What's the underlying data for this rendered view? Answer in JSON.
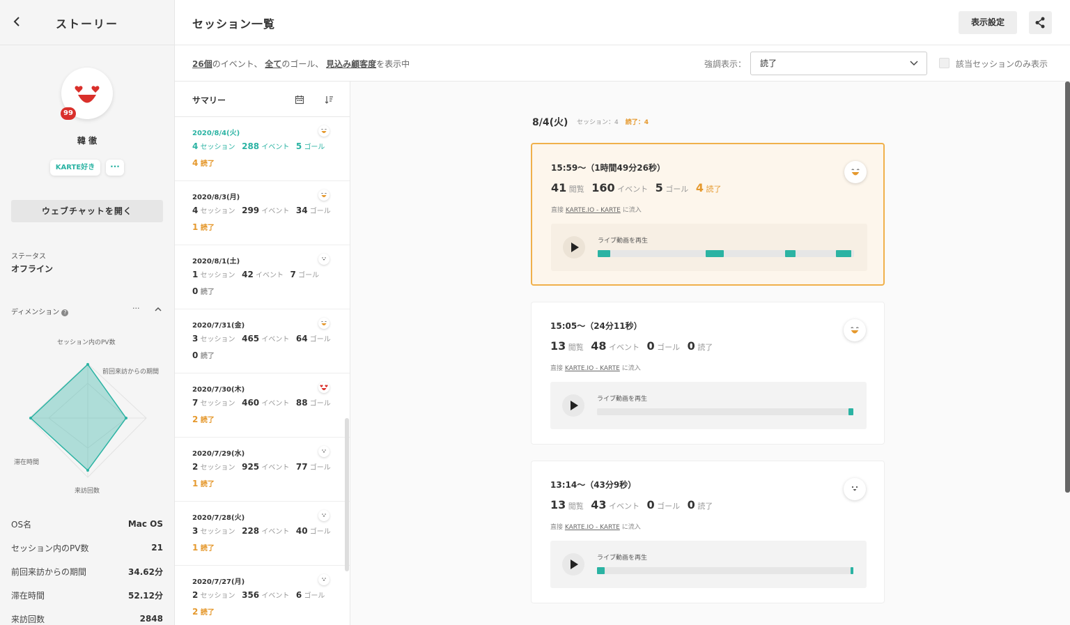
{
  "profile": {
    "title": "ストーリー",
    "badge": "99",
    "name": "韓 徹",
    "tag": "KARTE好き",
    "more": "···",
    "webchat_button": "ウェブチャットを開く",
    "status_label": "ステータス",
    "status_value": "オフライン",
    "dimension_title": "ディメンション",
    "dimension_help": "?",
    "dimension_more": "···",
    "radar_labels": {
      "top": "セッション内のPV数",
      "right": "前回来訪からの期間",
      "left": "滞在時間",
      "bottom": "来訪回数"
    },
    "stats": [
      {
        "label": "OS名",
        "value": "Mac OS"
      },
      {
        "label": "セッション内のPV数",
        "value": "21"
      },
      {
        "label": "前回来訪からの期間",
        "value": "34.62分"
      },
      {
        "label": "滞在時間",
        "value": "52.12分"
      },
      {
        "label": "来訪回数",
        "value": "2848"
      }
    ]
  },
  "header": {
    "title": "セッション一覧",
    "display_settings": "表示設定"
  },
  "filter": {
    "events_count": "26個",
    "events_text": "のイベント、",
    "goals_link": "全て",
    "goals_text": "のゴール、",
    "segment_link": "見込み顧客度",
    "segment_text": "を表示中",
    "highlight_label": "強調表示：",
    "highlight_value": "読了",
    "only_label": "該当セッションのみ表示"
  },
  "summary": {
    "title": "サマリー",
    "unit_session": "セッション",
    "unit_event": "イベント",
    "unit_goal": "ゴール",
    "unit_read": "読了",
    "days": [
      {
        "date": "2020/8/4(火)",
        "sessions": "4",
        "events": "288",
        "goals": "5",
        "reads": "4",
        "mood": "happy",
        "active": true
      },
      {
        "date": "2020/8/3(月)",
        "sessions": "4",
        "events": "299",
        "goals": "34",
        "reads": "1",
        "mood": "happy",
        "active": false
      },
      {
        "date": "2020/8/1(土)",
        "sessions": "1",
        "events": "42",
        "goals": "7",
        "reads": "0",
        "mood": "neutral",
        "active": false
      },
      {
        "date": "2020/7/31(金)",
        "sessions": "3",
        "events": "465",
        "goals": "64",
        "reads": "0",
        "mood": "happy",
        "active": false
      },
      {
        "date": "2020/7/30(木)",
        "sessions": "7",
        "events": "460",
        "goals": "88",
        "reads": "2",
        "mood": "love",
        "active": false
      },
      {
        "date": "2020/7/29(水)",
        "sessions": "2",
        "events": "925",
        "goals": "77",
        "reads": "1",
        "mood": "neutral",
        "active": false
      },
      {
        "date": "2020/7/28(火)",
        "sessions": "3",
        "events": "228",
        "goals": "40",
        "reads": "1",
        "mood": "neutral",
        "active": false
      },
      {
        "date": "2020/7/27(月)",
        "sessions": "2",
        "events": "356",
        "goals": "6",
        "reads": "2",
        "mood": "neutral",
        "active": false
      }
    ]
  },
  "detail": {
    "day": "8/4(火)",
    "sessions_label": "セッション：4",
    "reads_label": "読了：4",
    "unit_view": "閲覧",
    "unit_event": "イベント",
    "unit_goal": "ゴール",
    "unit_read": "読了",
    "play_label": "ライブ動画を再生",
    "sessions": [
      {
        "time": "15:59〜（1時間49分26秒）",
        "views": "41",
        "events": "160",
        "goals": "5",
        "reads": "4",
        "source_prefix": "直接",
        "source_link": "KARTE.IO - KARTE",
        "source_suffix": "に流入",
        "highlight": true,
        "mood": "happy",
        "timeline": [
          [
            0.0,
            0.05
          ],
          [
            0.42,
            0.49
          ],
          [
            0.73,
            0.77
          ],
          [
            0.93,
            0.99
          ]
        ]
      },
      {
        "time": "15:05〜（24分11秒）",
        "views": "13",
        "events": "48",
        "goals": "0",
        "reads": "0",
        "source_prefix": "直接",
        "source_link": "KARTE.IO - KARTE",
        "source_suffix": "に流入",
        "highlight": false,
        "mood": "happy",
        "timeline": [
          [
            0.98,
            1.0
          ]
        ]
      },
      {
        "time": "13:14〜（43分9秒）",
        "views": "13",
        "events": "43",
        "goals": "0",
        "reads": "0",
        "source_prefix": "直接",
        "source_link": "KARTE.IO - KARTE",
        "source_suffix": "に流入",
        "highlight": false,
        "mood": "neutral",
        "timeline": [
          [
            0.0,
            0.03
          ],
          [
            0.99,
            1.0
          ]
        ]
      }
    ]
  },
  "colors": {
    "accent": "#2bb3a3",
    "read": "#e5992e",
    "alert": "#d9302b"
  }
}
